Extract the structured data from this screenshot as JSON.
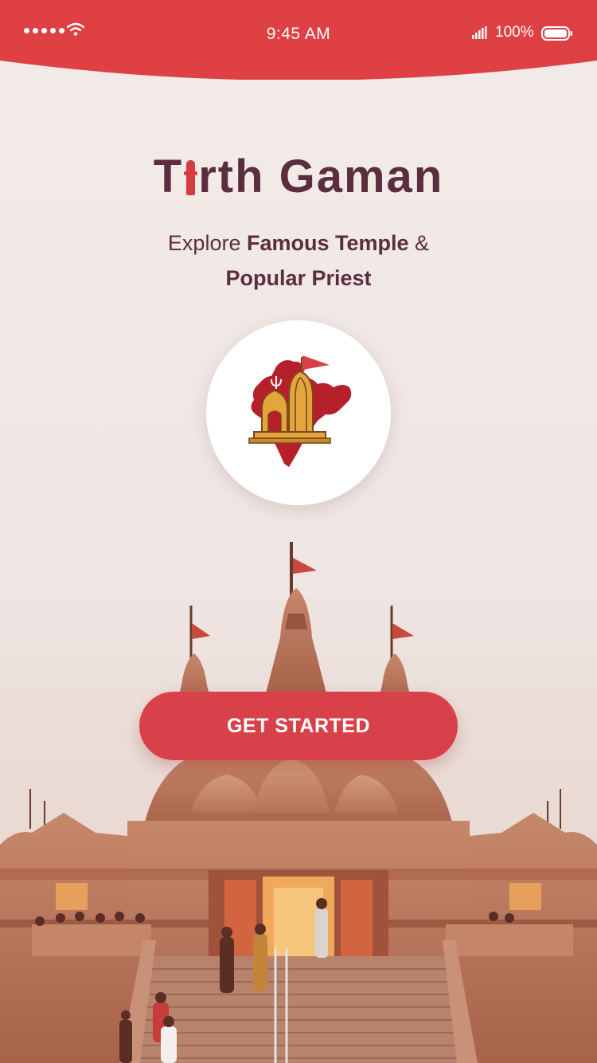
{
  "status_bar": {
    "time": "9:45 AM",
    "battery_percent": "100%",
    "signal_dots": 5,
    "icons": [
      "signal-dots-icon",
      "wifi-icon",
      "cellular-signal-icon",
      "battery-icon"
    ]
  },
  "brand": {
    "title_prefix": "T",
    "title_suffix": "rth Gaman",
    "logo_icon": "india-map-temple-logo"
  },
  "tagline": {
    "explore": "Explore",
    "famous_temple": "Famous Temple",
    "ampersand": "&",
    "popular_priest": "Popular Priest"
  },
  "cta": {
    "label": "GET STARTED"
  },
  "colors": {
    "accent": "#d9414a",
    "status_bar": "#de4044",
    "title": "#5c2d3f",
    "background": "#efe7e4",
    "temple_stone": "#c98a6c"
  }
}
